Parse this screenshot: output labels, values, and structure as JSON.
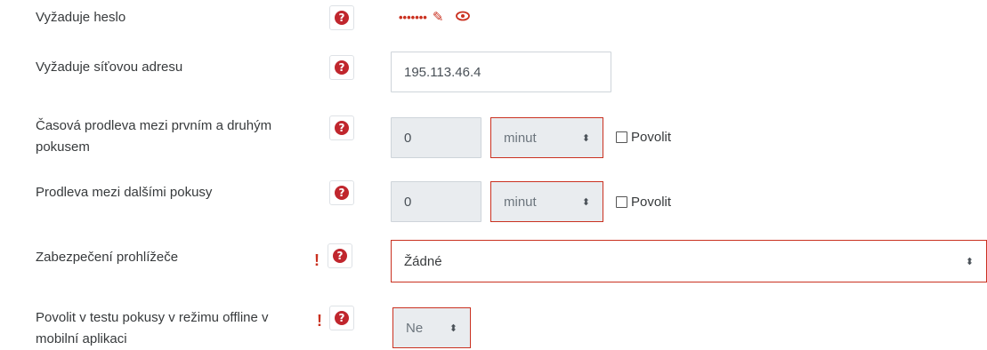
{
  "help_glyph": "?",
  "advanced_glyph": "!",
  "require_password": {
    "label": "Vyžaduje heslo",
    "masked_value": "•••••••",
    "edit_icon": "pencil-icon",
    "reveal_icon": "eye-icon"
  },
  "require_network_address": {
    "label": "Vyžaduje síťovou adresu",
    "value": "195.113.46.4"
  },
  "delay_first_second": {
    "label_line1": "Časová prodleva mezi prvním a druhým",
    "label_line2": "pokusem",
    "value": "0",
    "unit": "minut",
    "enable_label": "Povolit"
  },
  "delay_later": {
    "label": "Prodleva mezi dalšími pokusy",
    "value": "0",
    "unit": "minut",
    "enable_label": "Povolit"
  },
  "browser_security": {
    "label": "Zabezpečení prohlížeče",
    "value": "Žádné"
  },
  "offline_attempts": {
    "label_line1": "Povolit v testu pokusy v režimu offline v",
    "label_line2": "mobilní aplikaci",
    "value": "Ne"
  },
  "colors": {
    "accent_red": "#ca3120",
    "help_red": "#c0262d"
  }
}
